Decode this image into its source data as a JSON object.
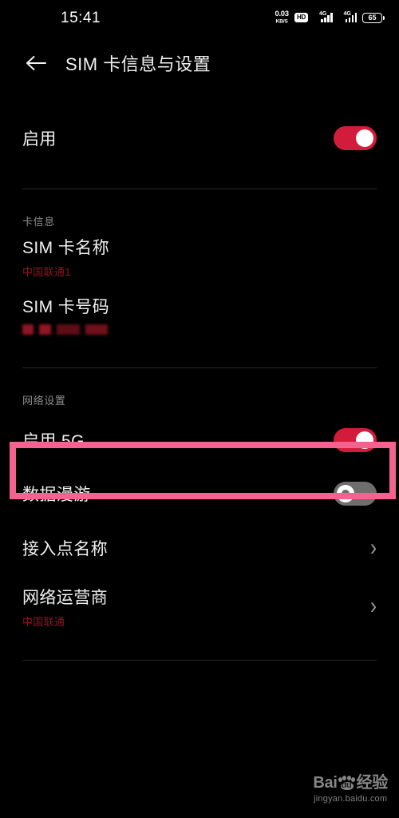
{
  "status_bar": {
    "time": "15:41",
    "net_speed_value": "0.03",
    "net_speed_unit": "KB/S",
    "hd_label": "HD",
    "sim1_network": "4G",
    "sim2_network": "4G",
    "battery_level": "65"
  },
  "app_bar": {
    "back_icon": "back-arrow-icon",
    "title": "SIM 卡信息与设置"
  },
  "enable_row": {
    "label": "启用",
    "toggle_state": "on"
  },
  "card_info": {
    "section_label": "卡信息",
    "sim_name": {
      "label": "SIM 卡名称",
      "value": "中国联通1"
    },
    "sim_number": {
      "label": "SIM 卡号码",
      "value": "",
      "masked": true
    }
  },
  "network_settings": {
    "section_label": "网络设置",
    "enable_5g": {
      "label": "启用 5G",
      "toggle_state": "on",
      "highlighted": true
    },
    "data_roaming": {
      "label": "数据漫游",
      "toggle_state": "off"
    },
    "apn": {
      "label": "接入点名称",
      "chevron_icon": "chevron-right-icon"
    },
    "carrier": {
      "label": "网络运营商",
      "value": "中国联通",
      "chevron_icon": "chevron-right-icon"
    }
  },
  "watermark": {
    "brand_prefix": "Bai",
    "brand_paw_text": "du",
    "brand_suffix": "经验",
    "url": "jingyan.baidu.com"
  },
  "colors": {
    "background": "#000000",
    "toggle_on": "#d31c3b",
    "toggle_off": "#6e6e6e",
    "subtitle_red": "#8f1522",
    "highlight_pink": "#f4638f",
    "divider": "#262626"
  }
}
